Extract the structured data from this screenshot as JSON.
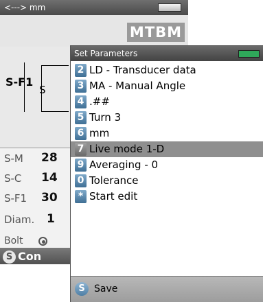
{
  "background": {
    "title": "<---> mm",
    "brand": "MTBM",
    "diagram": {
      "label_left": "S-F1",
      "label_inner": "S"
    },
    "rows": [
      {
        "label": "S-M",
        "value": "28"
      },
      {
        "label": "S-C",
        "value": "14"
      },
      {
        "label": "S-F1",
        "value": "30"
      },
      {
        "label": "Diam.",
        "value": "1"
      },
      {
        "label": "Bolt",
        "value": ""
      }
    ],
    "footer": {
      "icon_letter": "S",
      "label": "Con"
    }
  },
  "dialog": {
    "title": "Set Parameters",
    "items": [
      {
        "key": "2",
        "label": "LD - Transducer data"
      },
      {
        "key": "3",
        "label": "MA - Manual Angle"
      },
      {
        "key": "4",
        "label": ".##"
      },
      {
        "key": "5",
        "label": "Turn  3"
      },
      {
        "key": "6",
        "label": "mm"
      },
      {
        "key": "7",
        "label": "Live mode 1-D"
      },
      {
        "key": "9",
        "label": "Averaging - 0"
      },
      {
        "key": "0",
        "label": "Tolerance"
      },
      {
        "key": "*",
        "label": "Start edit"
      }
    ],
    "selected_index": 5,
    "footer": {
      "icon_letter": "S",
      "save_label": "Save"
    }
  },
  "icons": {
    "battery_bg": "battery-icon",
    "battery_dialog": "battery-icon",
    "bolt": "circle-dot-icon"
  },
  "colors": {
    "title_bar": "#4a4a4a",
    "selection": "#8f8f8f",
    "key_badge": "#3f6f95",
    "battery_green": "#2fa85a"
  }
}
